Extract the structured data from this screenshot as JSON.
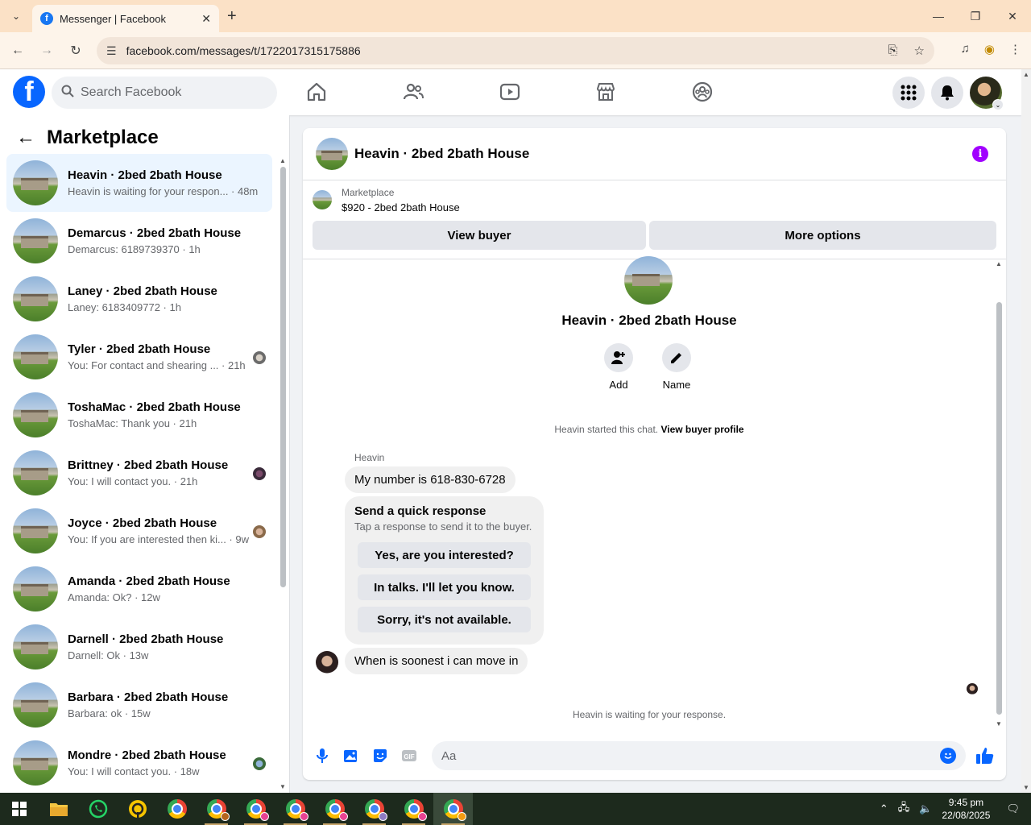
{
  "browser": {
    "tab_title": "Messenger | Facebook",
    "url": "facebook.com/messages/t/1722017315175886"
  },
  "fb": {
    "search_placeholder": "Search Facebook",
    "brand_color": "#0866ff"
  },
  "sidebar": {
    "title": "Marketplace",
    "conversations": [
      {
        "name": "Heavin · 2bed 2bath House",
        "preview": "Heavin is waiting for your respon... · 48m",
        "active": true
      },
      {
        "name": "Demarcus · 2bed 2bath House",
        "preview": "Demarcus: 6189739370 · 1h"
      },
      {
        "name": "Laney · 2bed 2bath House",
        "preview": "Laney: 6183409772 · 1h"
      },
      {
        "name": "Tyler · 2bed 2bath House",
        "preview": "You: For contact and shearing ... · 21h"
      },
      {
        "name": "ToshaMac · 2bed 2bath House",
        "preview": "ToshaMac: Thank you · 21h"
      },
      {
        "name": "Brittney · 2bed 2bath House",
        "preview": "You: I will contact you. · 21h"
      },
      {
        "name": "Joyce · 2bed 2bath House",
        "preview": "You: If you are interested then ki... · 9w"
      },
      {
        "name": "Amanda · 2bed 2bath House",
        "preview": "Amanda: Ok? · 12w"
      },
      {
        "name": "Darnell · 2bed 2bath House",
        "preview": "Darnell: Ok · 13w"
      },
      {
        "name": "Barbara · 2bed 2bath House",
        "preview": "Barbara: ok · 15w"
      },
      {
        "name": "Mondre · 2bed 2bath House",
        "preview": "You: I will contact you. · 18w"
      }
    ]
  },
  "chat": {
    "title": "Heavin · 2bed 2bath House",
    "marketplace_label": "Marketplace",
    "listing": "$920 - 2bed 2bath House",
    "view_buyer": "View buyer",
    "more_options": "More options",
    "hero_name": "Heavin · 2bed 2bath House",
    "add_label": "Add",
    "name_label": "Name",
    "started_text": "Heavin started this chat.",
    "view_buyer_profile": "View buyer profile",
    "sender": "Heavin",
    "messages": [
      "My number is 618-830-6728",
      "When is soonest i can move in"
    ],
    "quick_title": "Send a quick response",
    "quick_subtitle": "Tap a response to send it to the buyer.",
    "quick_options": [
      "Yes, are you interested?",
      "In talks. I'll let you know.",
      "Sorry, it's not available."
    ],
    "waiting": "Heavin is waiting for your response.",
    "composer_placeholder": "Aa",
    "accent": "#a100ff"
  },
  "taskbar": {
    "time": "9:45 pm",
    "date": "22/08/2025"
  }
}
